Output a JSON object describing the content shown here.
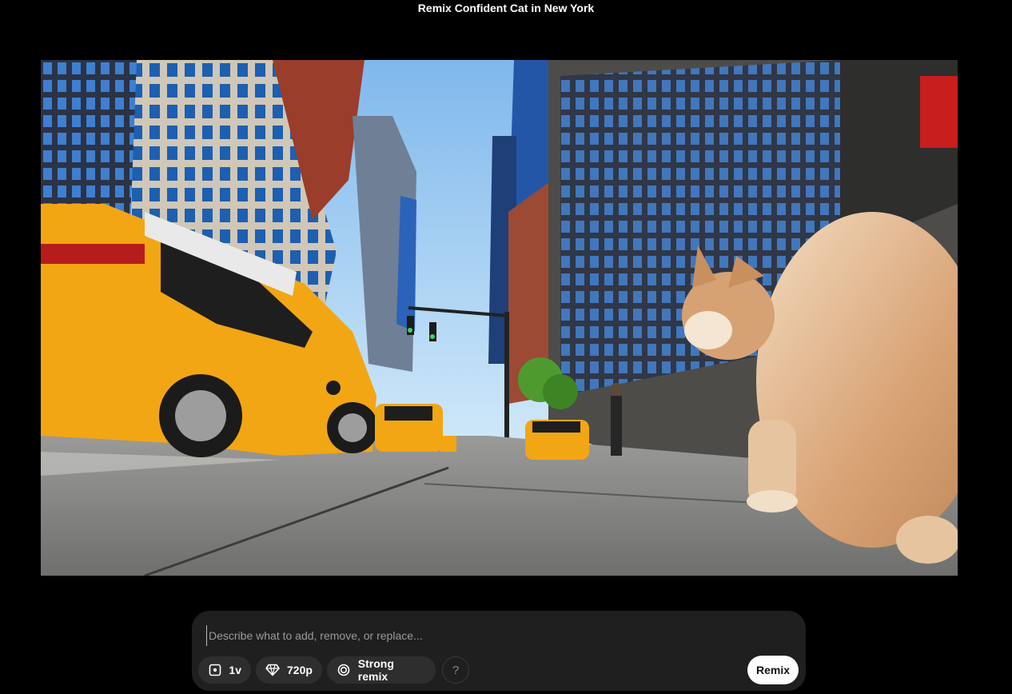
{
  "page": {
    "title": "Remix Confident Cat in New York"
  },
  "video": {
    "description_icon": "video-frame"
  },
  "composer": {
    "placeholder": "Describe what to add, remove, or replace...",
    "value": "",
    "chips": {
      "version": {
        "label": "1v",
        "icon": "video-square-icon"
      },
      "resolution": {
        "label": "720p",
        "icon": "diamond-icon"
      },
      "strength": {
        "label": "Strong remix",
        "icon": "spiral-icon"
      }
    },
    "help_label": "?",
    "remix_label": "Remix"
  },
  "colors": {
    "background": "#000000",
    "composer_bg": "#1f1f1f",
    "chip_bg": "#2e2e2e",
    "remix_button": "#ffffff"
  }
}
